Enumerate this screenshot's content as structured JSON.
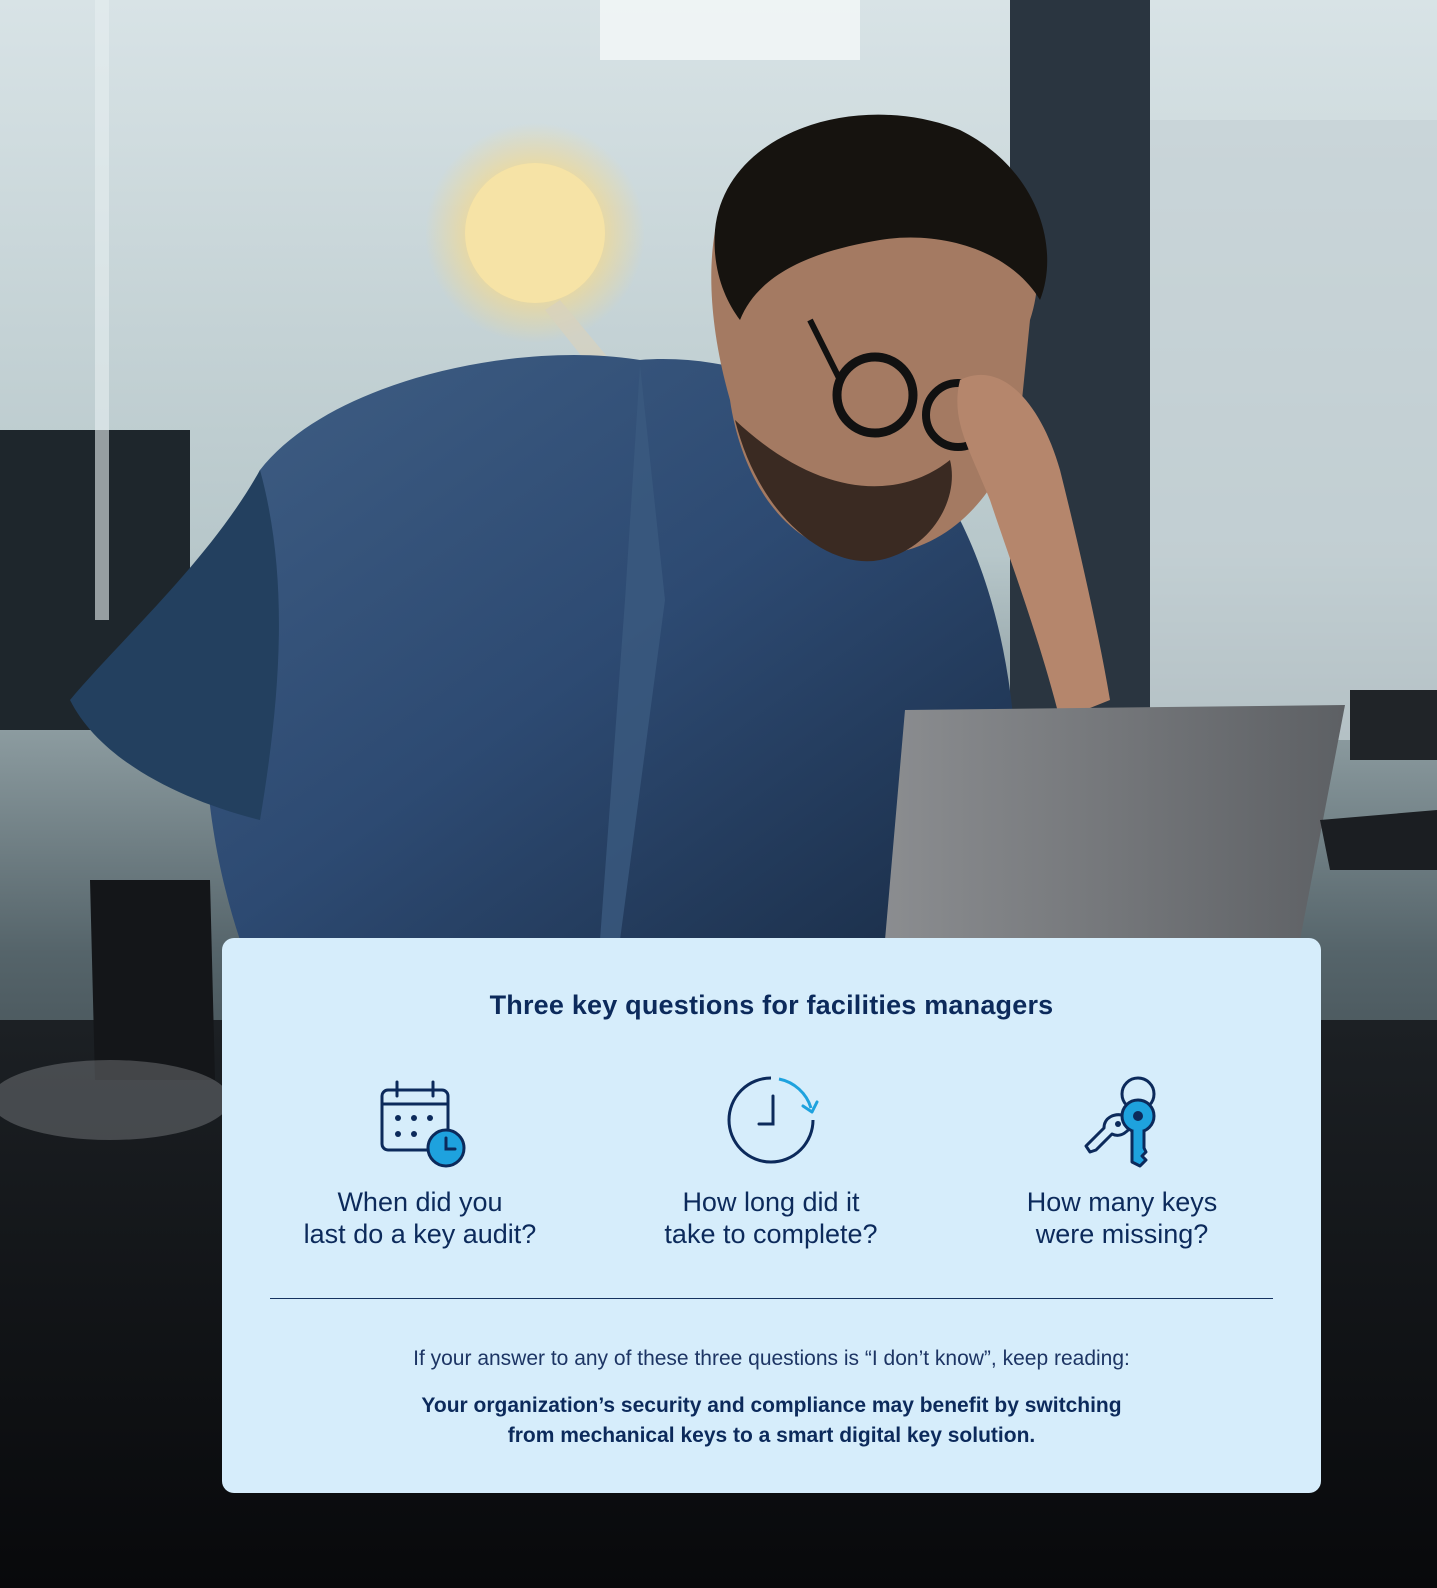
{
  "card": {
    "title": "Three key questions for facilities managers",
    "questions": [
      {
        "icon": "calendar-clock-icon",
        "text": "When did you\nlast do a key audit?"
      },
      {
        "icon": "clock-refresh-icon",
        "text": "How long did it\ntake to complete?"
      },
      {
        "icon": "keys-icon",
        "text": "How many keys\nwere missing?"
      }
    ],
    "lead": "If your answer to any of these three questions is “I don’t know”, keep reading:",
    "emphasis": "Your organization’s security and compliance may benefit by switching\nfrom mechanical keys to a smart digital key solution."
  },
  "colors": {
    "card_background": "#d6edfb",
    "navy": "#0c2a5b",
    "accent_blue": "#1ea2de"
  }
}
